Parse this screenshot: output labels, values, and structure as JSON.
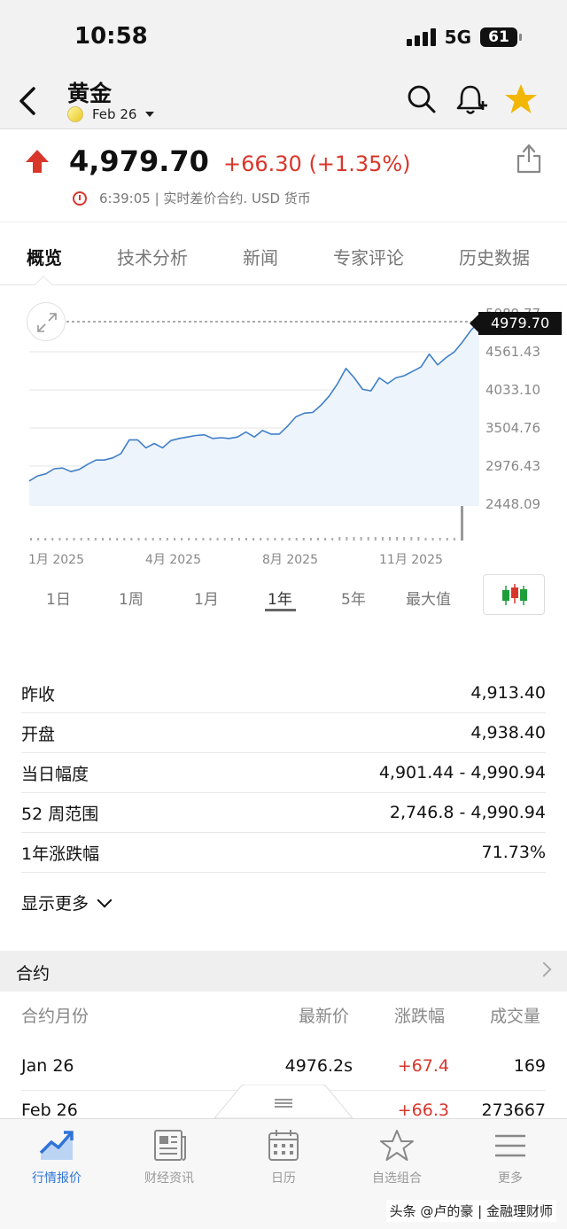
{
  "status_bar": {
    "time": "10:58",
    "network": "5G",
    "battery": "61"
  },
  "header": {
    "title": "黄金",
    "contract": "Feb 26"
  },
  "quote": {
    "price": "4,979.70",
    "change": "+66.30 (+1.35%)",
    "meta": "6:39:05 | 实时差价合约.  USD 货币",
    "colors": {
      "up": "#d9362b"
    }
  },
  "tabs": [
    {
      "label": "概览",
      "active": true
    },
    {
      "label": "技术分析"
    },
    {
      "label": "新闻"
    },
    {
      "label": "专家评论"
    },
    {
      "label": "历史数据"
    }
  ],
  "chart_data": {
    "type": "area",
    "last_value_label": "4979.70",
    "y_ticks": [
      "5089.77",
      "4561.43",
      "4033.10",
      "3504.76",
      "2976.43",
      "2448.09"
    ],
    "x_ticks": [
      "1月 2025",
      "4月 2025",
      "8月 2025",
      "11月 2025"
    ],
    "ylim": [
      2448.09,
      5089.77
    ],
    "series": [
      {
        "values": [
          2770,
          2840,
          2870,
          2940,
          2950,
          2900,
          2930,
          3000,
          3060,
          3060,
          3090,
          3150,
          3340,
          3340,
          3230,
          3290,
          3230,
          3330,
          3360,
          3380,
          3400,
          3410,
          3360,
          3370,
          3360,
          3380,
          3450,
          3380,
          3470,
          3420,
          3420,
          3530,
          3660,
          3710,
          3720,
          3820,
          3950,
          4120,
          4330,
          4200,
          4040,
          4020,
          4200,
          4120,
          4200,
          4230,
          4290,
          4350,
          4530,
          4380,
          4480,
          4560,
          4700,
          4860,
          4979.7
        ],
        "color": "#3f7fc8"
      }
    ],
    "grid": true
  },
  "ranges": [
    {
      "label": "1日"
    },
    {
      "label": "1周"
    },
    {
      "label": "1月"
    },
    {
      "label": "1年",
      "active": true
    },
    {
      "label": "5年"
    },
    {
      "label": "最大值"
    }
  ],
  "stats": [
    {
      "label": "昨收",
      "value": "4,913.40"
    },
    {
      "label": "开盘",
      "value": "4,938.40"
    },
    {
      "label": "当日幅度",
      "value": "4,901.44 - 4,990.94"
    },
    {
      "label": "52 周范围",
      "value": "2,746.8 - 4,990.94"
    },
    {
      "label": "1年涨跌幅",
      "value": "71.73%"
    }
  ],
  "show_more": "显示更多",
  "contracts": {
    "title": "合约",
    "headers": [
      "合约月份",
      "最新价",
      "涨跌幅",
      "成交量"
    ],
    "rows": [
      {
        "month": "Jan 26",
        "price": "4976.2s",
        "change": "+67.4",
        "volume": "169"
      },
      {
        "month": "Feb 26",
        "price": "",
        "change": "+66.3",
        "volume": "273667"
      }
    ]
  },
  "nav": [
    {
      "label": "行情报价",
      "icon": "chart-trend-icon",
      "active": true
    },
    {
      "label": "财经资讯",
      "icon": "newspaper-icon"
    },
    {
      "label": "日历",
      "icon": "calendar-icon"
    },
    {
      "label": "自选组合",
      "icon": "star-outline-icon"
    },
    {
      "label": "更多",
      "icon": "menu-icon"
    }
  ],
  "watermark": "头条 @卢的豪 | 金融理财师"
}
